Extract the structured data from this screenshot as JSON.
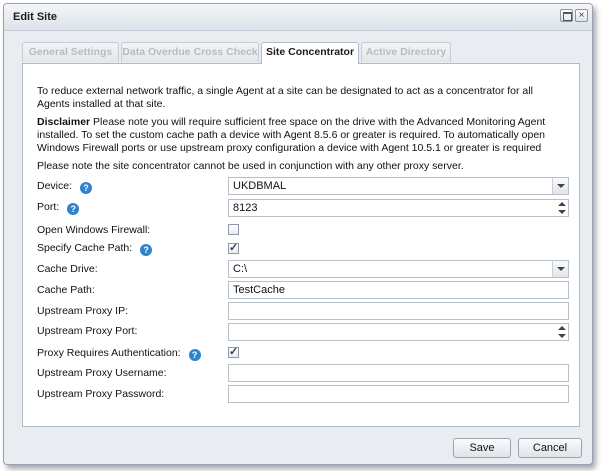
{
  "window": {
    "title": "Edit Site"
  },
  "tabs": [
    {
      "label": "General Settings",
      "active": false
    },
    {
      "label": "Data Overdue Cross Check",
      "active": false
    },
    {
      "label": "Site Concentrator",
      "active": true
    },
    {
      "label": "Active Directory",
      "active": false
    }
  ],
  "panel": {
    "intro": "To reduce external network traffic, a single Agent at a site can be designated to act as a concentrator for all Agents installed at that site.",
    "disclaimer_label": "Disclaimer",
    "disclaimer_text": " Please note you will require sufficient free space on the drive with the Advanced Monitoring Agent installed. To set the custom cache path a device with Agent 8.5.6 or greater is required. To automatically open Windows Firewall ports or use upstream proxy configuration a device with Agent 10.5.1 or greater is required",
    "note": "Please note the site concentrator cannot be used in conjunction with any other proxy server."
  },
  "form": {
    "device": {
      "label": "Device:",
      "value": "UKDBMAL"
    },
    "port": {
      "label": "Port:",
      "value": "8123"
    },
    "firewall": {
      "label": "Open Windows Firewall:",
      "checked": false
    },
    "specify_cache": {
      "label": "Specify Cache Path:",
      "checked": true
    },
    "cache_drive": {
      "label": "Cache Drive:",
      "value": "C:\\"
    },
    "cache_path": {
      "label": "Cache Path:",
      "value": "TestCache"
    },
    "proxy_ip": {
      "label": "Upstream Proxy IP:",
      "value": ""
    },
    "proxy_port": {
      "label": "Upstream Proxy Port:",
      "value": ""
    },
    "proxy_auth": {
      "label": "Proxy Requires Authentication:",
      "checked": true
    },
    "proxy_user": {
      "label": "Upstream Proxy Username:",
      "value": ""
    },
    "proxy_pass": {
      "label": "Upstream Proxy Password:",
      "value": ""
    }
  },
  "buttons": {
    "save": "Save",
    "cancel": "Cancel"
  },
  "icons": {
    "help": "help-icon",
    "maximize": "maximize-icon",
    "close": "close-icon"
  },
  "colors": {
    "help_blue": "#2f82cc",
    "tab_inactive_text": "#b6bcc4"
  }
}
